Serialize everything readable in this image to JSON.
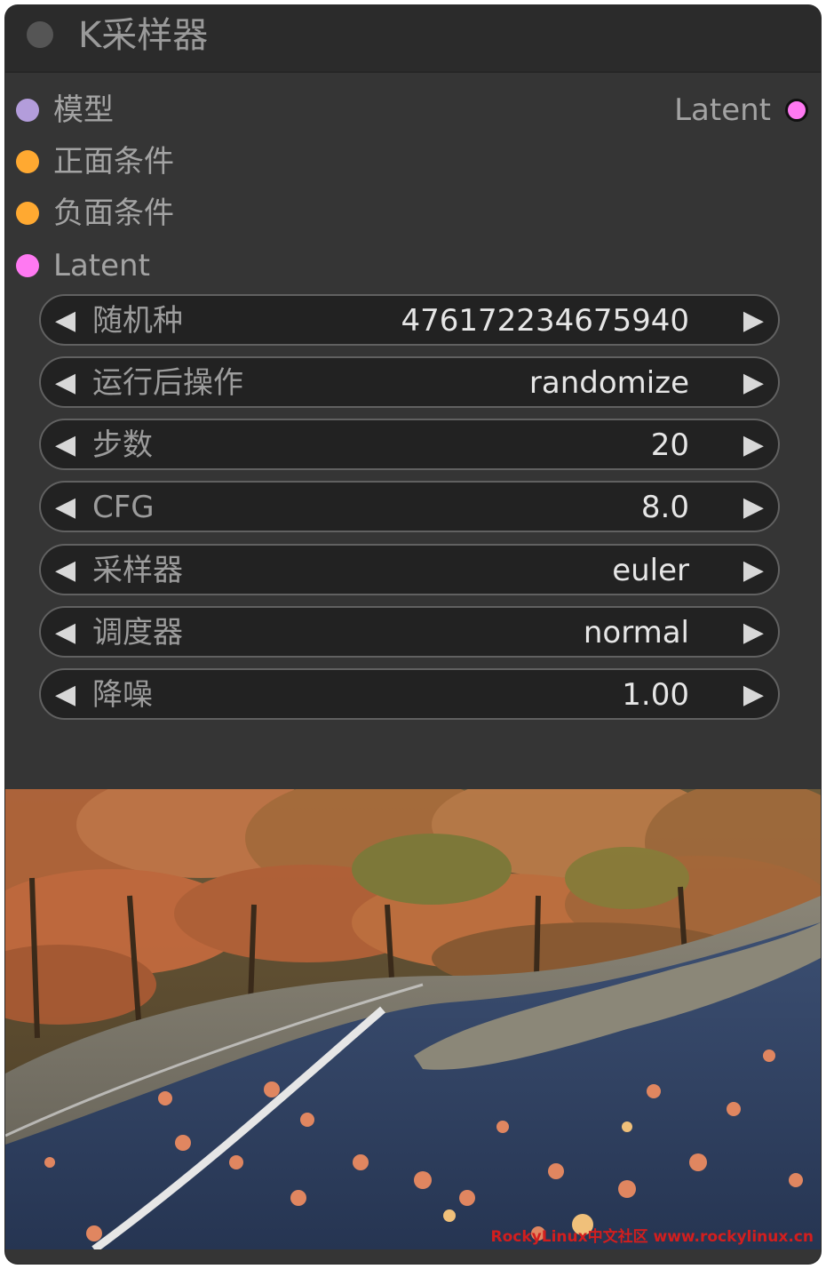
{
  "node": {
    "title": "K采样器"
  },
  "inputs": [
    {
      "label": "模型",
      "color": "#b39ddb"
    },
    {
      "label": "正面条件",
      "color": "#ffa931"
    },
    {
      "label": "负面条件",
      "color": "#ffa931"
    },
    {
      "label": "Latent",
      "color": "#ff79f2"
    }
  ],
  "outputs": [
    {
      "label": "Latent",
      "color": "#ff79f2"
    }
  ],
  "widgets": [
    {
      "label": "随机种",
      "value": "476172234675940"
    },
    {
      "label": "运行后操作",
      "value": "randomize"
    },
    {
      "label": "步数",
      "value": "20"
    },
    {
      "label": "CFG",
      "value": "8.0"
    },
    {
      "label": "采样器",
      "value": "euler"
    },
    {
      "label": "调度器",
      "value": "normal"
    },
    {
      "label": "降噪",
      "value": "1.00"
    }
  ],
  "arrows": {
    "left": "◀",
    "right": "▶"
  },
  "preview": {
    "watermark": "RockyLinux中文社区 www.rockylinux.cn"
  }
}
